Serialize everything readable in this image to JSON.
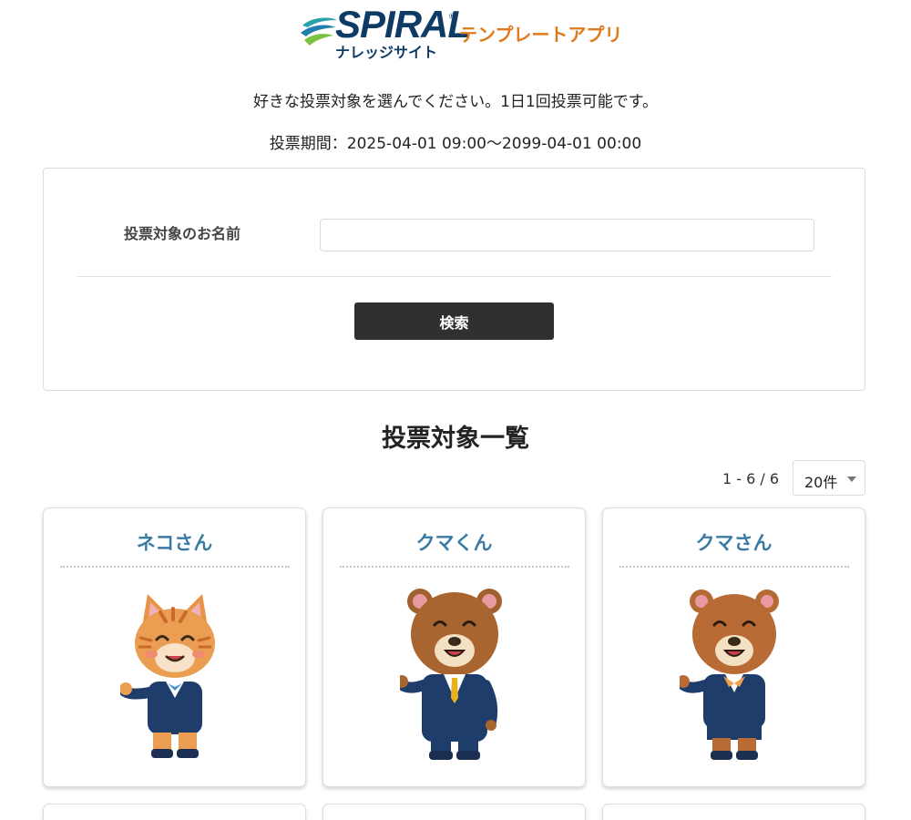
{
  "header": {
    "logo_text": "SPIRAL",
    "logo_registered": "®",
    "app_label": "テンプレートアプリ",
    "site_label": "ナレッジサイト"
  },
  "intro": {
    "instruction": "好きな投票対象を選んでください。1日1回投票可能です。",
    "period": "投票期間：2025-04-01 09:00～2099-04-01 00:00"
  },
  "search": {
    "name_label": "投票対象のお名前",
    "name_value": "",
    "button_label": "検索"
  },
  "list": {
    "title": "投票対象一覧",
    "pagination": "1 - 6 /  6",
    "per_page": "20件",
    "candidates": [
      {
        "name": "ネコさん",
        "image": "cat-businessperson"
      },
      {
        "name": "クマくん",
        "image": "bear-businessman"
      },
      {
        "name": "クマさん",
        "image": "bear-businesswoman"
      }
    ]
  },
  "colors": {
    "brand_navy": "#0d3b66",
    "brand_orange": "#e07b1c",
    "card_title": "#3a7ba4",
    "button_bg": "#303030"
  }
}
